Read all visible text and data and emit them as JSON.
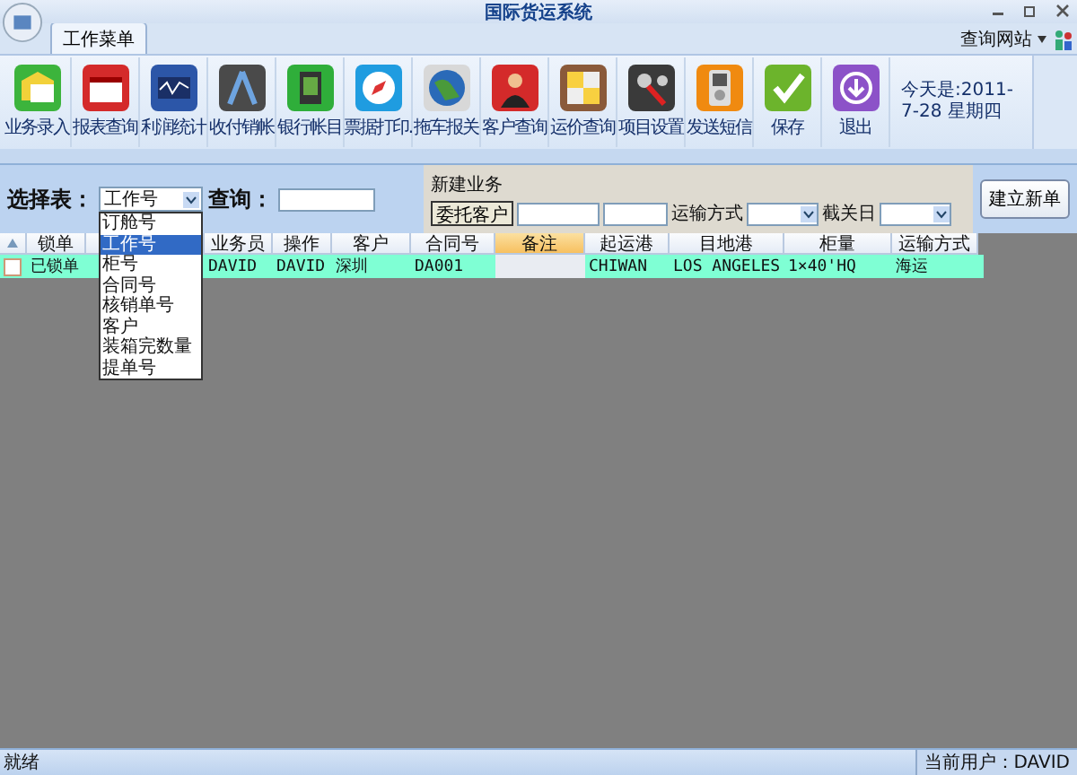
{
  "window": {
    "title": "国际货运系统"
  },
  "ribbon": {
    "tabs": [
      {
        "label": "工作菜单",
        "selected": true
      }
    ],
    "site_link": "查询网站",
    "buttons": [
      "业务录入",
      "报表查询",
      "利润统计",
      "收付销帐",
      "银行帐目",
      "票据打印.",
      "拖车报关",
      "客户查询",
      "运价查询",
      "项目设置",
      "发送短信",
      "保存",
      "退出"
    ],
    "date": "今天是:2011-7-28 星期四"
  },
  "filter": {
    "label": "选择表：",
    "query_label": "查询：",
    "table_select": {
      "value": "工作号",
      "expanded": true,
      "options": [
        {
          "label": "订舱号",
          "selected": false
        },
        {
          "label": "工作号",
          "selected": true
        },
        {
          "label": "柜号",
          "selected": false
        },
        {
          "label": "合同号",
          "selected": false
        },
        {
          "label": "核销单号",
          "selected": false
        },
        {
          "label": "客户",
          "selected": false
        },
        {
          "label": "装箱完数量",
          "selected": false
        },
        {
          "label": "提单号",
          "selected": false
        }
      ]
    }
  },
  "new_business": {
    "title": "新建业务",
    "customer_button": "委托客户",
    "transport_label": "运输方式",
    "cutoff_label": "截关日",
    "create_button": "建立新单"
  },
  "table": {
    "columns": [
      {
        "label": "锁单",
        "highlighted": false
      },
      {
        "highlighted": false
      },
      {
        "label": "业务员",
        "highlighted": false
      },
      {
        "label": "操作",
        "highlighted": false
      },
      {
        "label": "客户",
        "highlighted": false
      },
      {
        "label": "合同号",
        "highlighted": false
      },
      {
        "label": "备注",
        "highlighted": true
      },
      {
        "label": "起运港",
        "highlighted": false
      },
      {
        "label": "目地港",
        "highlighted": false
      },
      {
        "label": "柜量",
        "highlighted": false
      },
      {
        "label": "运输方式",
        "highlighted": false
      }
    ],
    "rows": [
      {
        "checked": false,
        "cells": [
          "已锁单",
          null,
          "DAVID",
          "DAVID",
          "深圳",
          "DA001",
          null,
          "CHIWAN",
          "LOS ANGELES",
          "1×40'HQ",
          "海运"
        ]
      }
    ]
  },
  "status_bar": {
    "text": "就绪",
    "user": "当前用户：DAVID"
  }
}
